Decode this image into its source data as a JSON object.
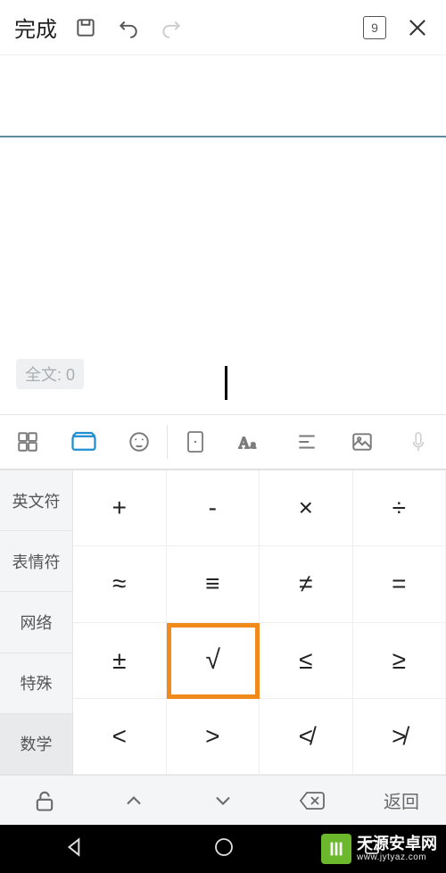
{
  "topbar": {
    "done_label": "完成",
    "page_number": "9"
  },
  "wordcount": {
    "prefix": "全文: ",
    "value": "0"
  },
  "keyboard": {
    "tabs": [
      "英文符",
      "表情符",
      "网络",
      "特殊",
      "数学"
    ],
    "active_tab_index": 4,
    "grid": [
      [
        "+",
        "-",
        "×",
        "÷"
      ],
      [
        "≈",
        "≡",
        "≠",
        "="
      ],
      [
        "±",
        "√",
        "≤",
        "≥"
      ],
      [
        "<",
        ">",
        "≮",
        "≯"
      ]
    ],
    "highlight": {
      "row": 2,
      "col": 1
    }
  },
  "ctrlbar": {
    "return_label": "返回"
  },
  "watermark": {
    "title": "天源安卓网",
    "url": "www.jytyaz.com"
  }
}
